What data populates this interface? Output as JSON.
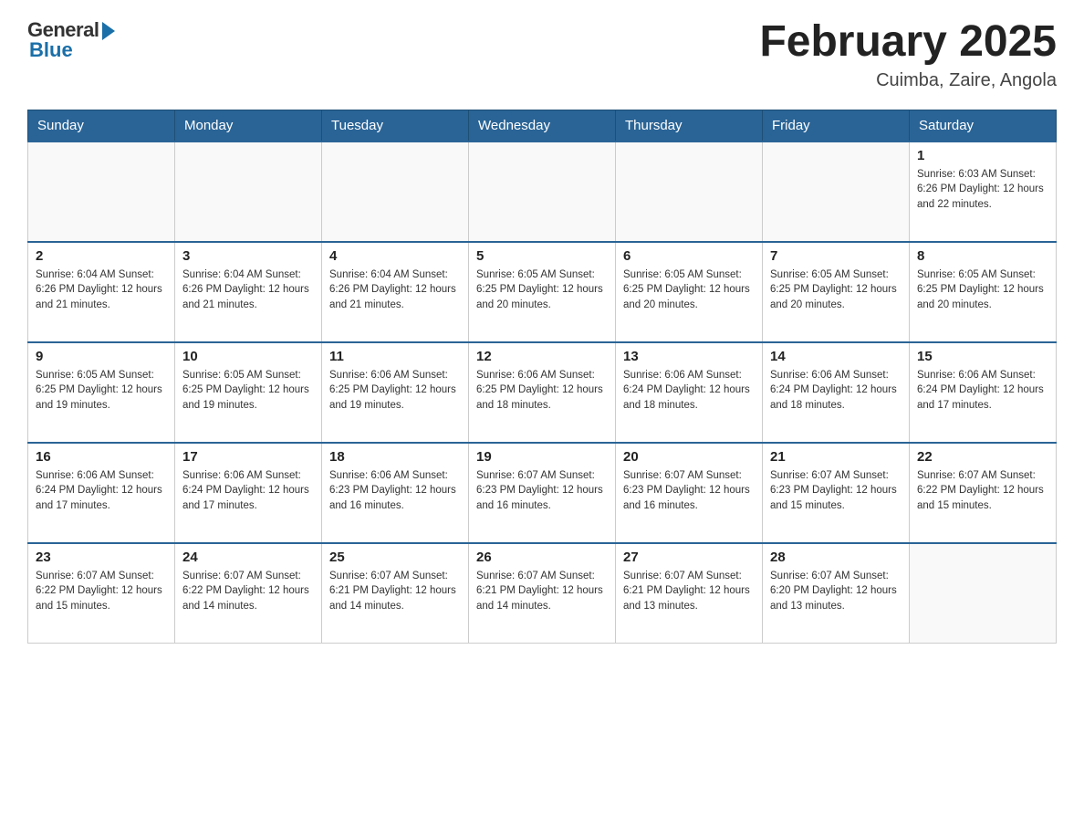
{
  "header": {
    "logo_general": "General",
    "logo_blue": "Blue",
    "month_year": "February 2025",
    "location": "Cuimba, Zaire, Angola"
  },
  "weekdays": [
    "Sunday",
    "Monday",
    "Tuesday",
    "Wednesday",
    "Thursday",
    "Friday",
    "Saturday"
  ],
  "weeks": [
    [
      {
        "day": "",
        "info": ""
      },
      {
        "day": "",
        "info": ""
      },
      {
        "day": "",
        "info": ""
      },
      {
        "day": "",
        "info": ""
      },
      {
        "day": "",
        "info": ""
      },
      {
        "day": "",
        "info": ""
      },
      {
        "day": "1",
        "info": "Sunrise: 6:03 AM\nSunset: 6:26 PM\nDaylight: 12 hours and 22 minutes."
      }
    ],
    [
      {
        "day": "2",
        "info": "Sunrise: 6:04 AM\nSunset: 6:26 PM\nDaylight: 12 hours and 21 minutes."
      },
      {
        "day": "3",
        "info": "Sunrise: 6:04 AM\nSunset: 6:26 PM\nDaylight: 12 hours and 21 minutes."
      },
      {
        "day": "4",
        "info": "Sunrise: 6:04 AM\nSunset: 6:26 PM\nDaylight: 12 hours and 21 minutes."
      },
      {
        "day": "5",
        "info": "Sunrise: 6:05 AM\nSunset: 6:25 PM\nDaylight: 12 hours and 20 minutes."
      },
      {
        "day": "6",
        "info": "Sunrise: 6:05 AM\nSunset: 6:25 PM\nDaylight: 12 hours and 20 minutes."
      },
      {
        "day": "7",
        "info": "Sunrise: 6:05 AM\nSunset: 6:25 PM\nDaylight: 12 hours and 20 minutes."
      },
      {
        "day": "8",
        "info": "Sunrise: 6:05 AM\nSunset: 6:25 PM\nDaylight: 12 hours and 20 minutes."
      }
    ],
    [
      {
        "day": "9",
        "info": "Sunrise: 6:05 AM\nSunset: 6:25 PM\nDaylight: 12 hours and 19 minutes."
      },
      {
        "day": "10",
        "info": "Sunrise: 6:05 AM\nSunset: 6:25 PM\nDaylight: 12 hours and 19 minutes."
      },
      {
        "day": "11",
        "info": "Sunrise: 6:06 AM\nSunset: 6:25 PM\nDaylight: 12 hours and 19 minutes."
      },
      {
        "day": "12",
        "info": "Sunrise: 6:06 AM\nSunset: 6:25 PM\nDaylight: 12 hours and 18 minutes."
      },
      {
        "day": "13",
        "info": "Sunrise: 6:06 AM\nSunset: 6:24 PM\nDaylight: 12 hours and 18 minutes."
      },
      {
        "day": "14",
        "info": "Sunrise: 6:06 AM\nSunset: 6:24 PM\nDaylight: 12 hours and 18 minutes."
      },
      {
        "day": "15",
        "info": "Sunrise: 6:06 AM\nSunset: 6:24 PM\nDaylight: 12 hours and 17 minutes."
      }
    ],
    [
      {
        "day": "16",
        "info": "Sunrise: 6:06 AM\nSunset: 6:24 PM\nDaylight: 12 hours and 17 minutes."
      },
      {
        "day": "17",
        "info": "Sunrise: 6:06 AM\nSunset: 6:24 PM\nDaylight: 12 hours and 17 minutes."
      },
      {
        "day": "18",
        "info": "Sunrise: 6:06 AM\nSunset: 6:23 PM\nDaylight: 12 hours and 16 minutes."
      },
      {
        "day": "19",
        "info": "Sunrise: 6:07 AM\nSunset: 6:23 PM\nDaylight: 12 hours and 16 minutes."
      },
      {
        "day": "20",
        "info": "Sunrise: 6:07 AM\nSunset: 6:23 PM\nDaylight: 12 hours and 16 minutes."
      },
      {
        "day": "21",
        "info": "Sunrise: 6:07 AM\nSunset: 6:23 PM\nDaylight: 12 hours and 15 minutes."
      },
      {
        "day": "22",
        "info": "Sunrise: 6:07 AM\nSunset: 6:22 PM\nDaylight: 12 hours and 15 minutes."
      }
    ],
    [
      {
        "day": "23",
        "info": "Sunrise: 6:07 AM\nSunset: 6:22 PM\nDaylight: 12 hours and 15 minutes."
      },
      {
        "day": "24",
        "info": "Sunrise: 6:07 AM\nSunset: 6:22 PM\nDaylight: 12 hours and 14 minutes."
      },
      {
        "day": "25",
        "info": "Sunrise: 6:07 AM\nSunset: 6:21 PM\nDaylight: 12 hours and 14 minutes."
      },
      {
        "day": "26",
        "info": "Sunrise: 6:07 AM\nSunset: 6:21 PM\nDaylight: 12 hours and 14 minutes."
      },
      {
        "day": "27",
        "info": "Sunrise: 6:07 AM\nSunset: 6:21 PM\nDaylight: 12 hours and 13 minutes."
      },
      {
        "day": "28",
        "info": "Sunrise: 6:07 AM\nSunset: 6:20 PM\nDaylight: 12 hours and 13 minutes."
      },
      {
        "day": "",
        "info": ""
      }
    ]
  ]
}
